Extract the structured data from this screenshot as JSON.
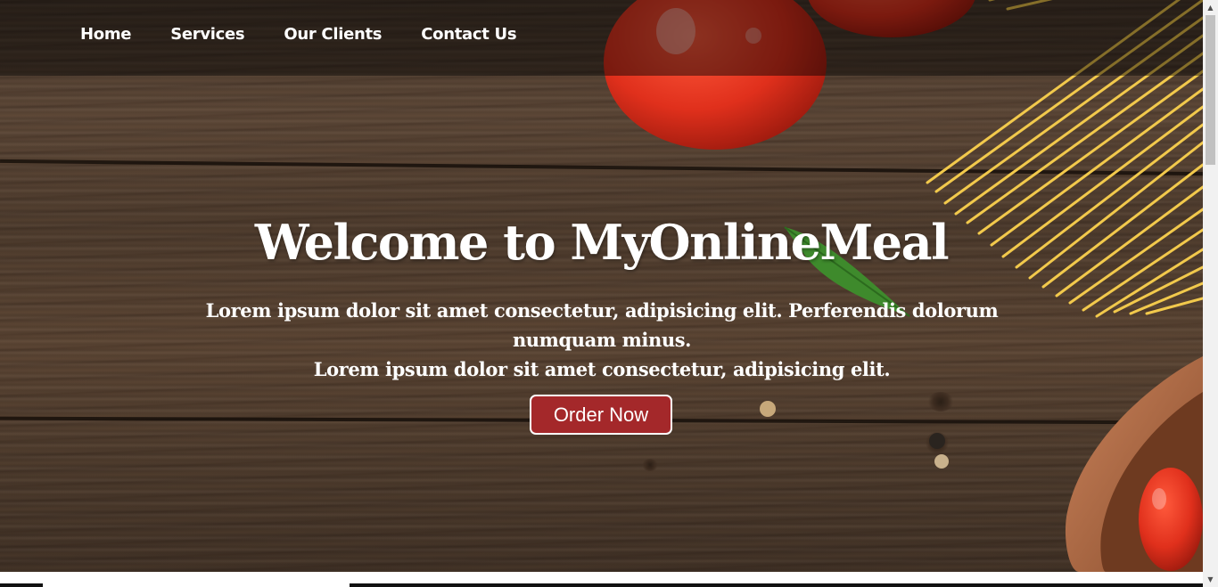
{
  "nav": {
    "items": [
      {
        "label": "Home"
      },
      {
        "label": "Services"
      },
      {
        "label": "Our Clients"
      },
      {
        "label": "Contact Us"
      }
    ]
  },
  "hero": {
    "title": "Welcome to MyOnlineMeal",
    "paragraph_line1": "Lorem ipsum dolor sit amet consectetur, adipisicing elit. Perferendis dolorum numquam minus.",
    "paragraph_line2": "Lorem ipsum dolor sit amet consectetur, adipisicing elit.",
    "order_button": "Order Now"
  },
  "colors": {
    "accent_button": "#a4282a",
    "nav_overlay": "rgba(0,0,0,0.45)",
    "text": "#ffffff"
  },
  "icons": {
    "scroll_up": "scroll-up-arrow-icon",
    "scroll_down": "scroll-down-arrow-icon"
  }
}
